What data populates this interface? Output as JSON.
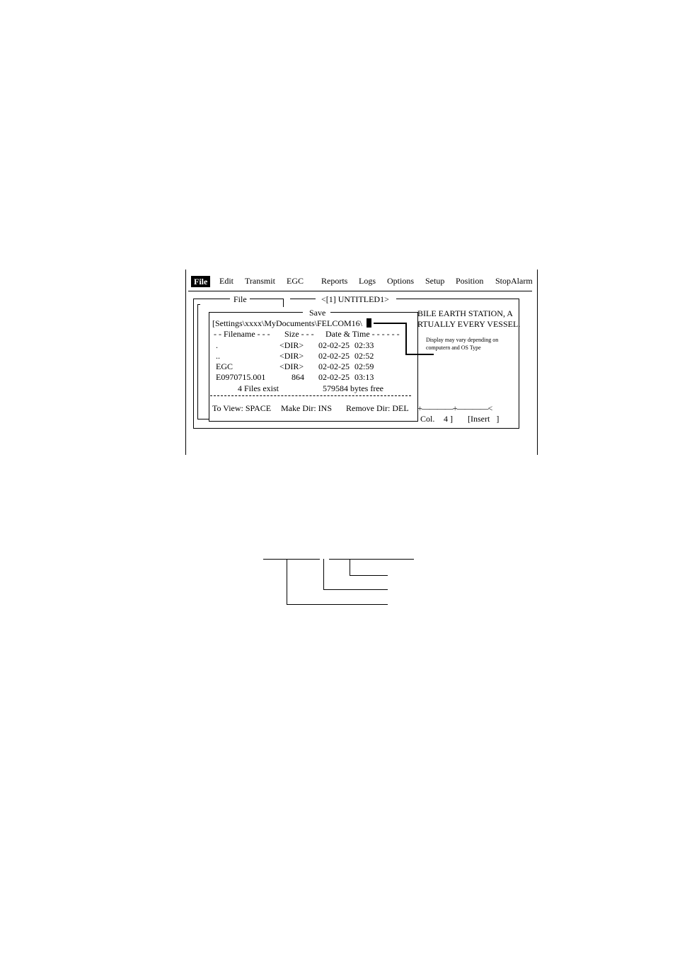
{
  "menubar": {
    "items": [
      "File",
      "Edit",
      "Transmit",
      "EGC",
      "Reports",
      "Logs",
      "Options",
      "Setup",
      "Position",
      "StopAlarm"
    ]
  },
  "editor": {
    "file_panel_title": "File",
    "doc_title": "<[1] UNTITLED1>",
    "background_text_line1": "BILE EARTH STATION, A",
    "background_text_line2": "RTUALLY EVERY VESSEL.",
    "ruler": "+————+————<",
    "status_col": "Col.",
    "status_col_value": "4 ]",
    "status_mode": "[Insert ]"
  },
  "save_dialog": {
    "title": "Save",
    "path": "[Settings\\xxxx\\MyDocuments\\FELCOM16\\",
    "header": {
      "filename": "- - Filename - - -",
      "size": "Size - - -",
      "datetime": "Date & Time - - - - - -"
    },
    "rows": [
      {
        "name": ".",
        "size": "<DIR>",
        "date": "02-02-25",
        "time": "02:33"
      },
      {
        "name": "..",
        "size": "<DIR>",
        "date": "02-02-25",
        "time": "02:52"
      },
      {
        "name": "EGC",
        "size": "<DIR>",
        "date": "02-02-25",
        "time": "02:59"
      },
      {
        "name": "E0970715.001",
        "size": "864",
        "date": "02-02-25",
        "time": "03:13"
      }
    ],
    "summary_files": "4  Files exist",
    "summary_bytes": "579584 bytes free",
    "footer_view": "To View: SPACE",
    "footer_makedir": "Make Dir: INS",
    "footer_removedir": "Remove Dir: DEL"
  },
  "callout": {
    "line1": "Display may vary depending on",
    "line2": "computern and OS Type"
  }
}
